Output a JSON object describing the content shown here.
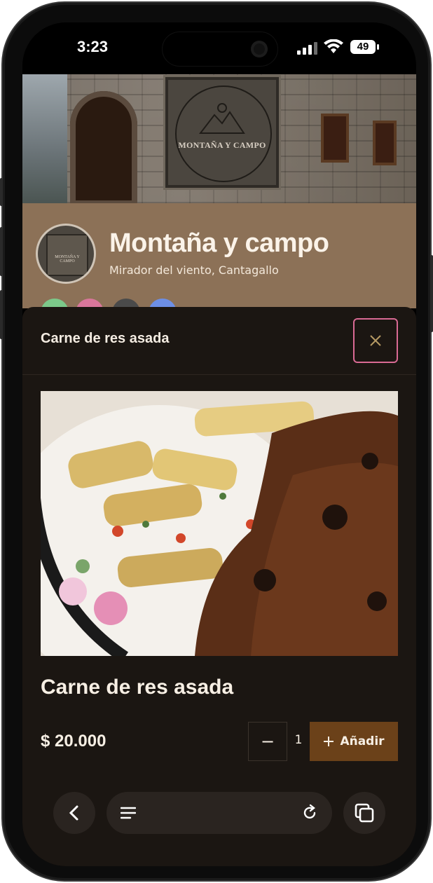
{
  "status_bar": {
    "time": "3:23",
    "battery_level": "49"
  },
  "restaurant": {
    "sign_text": "MONTAÑA Y CAMPO",
    "logo_text": "MONTAÑA Y CAMPO",
    "name": "Montaña y campo",
    "location": "Mirador del viento, Cantagallo",
    "social_dots": [
      {
        "color": "#7cc98a"
      },
      {
        "color": "#d9769b"
      },
      {
        "color": "#4a4a4a"
      },
      {
        "color": "#6d8fe6"
      }
    ]
  },
  "modal": {
    "header_title": "Carne de res asada",
    "close_icon": "close-icon",
    "product_name": "Carne de res asada",
    "price": "$ 20.000",
    "quantity": "1",
    "decrement_label": "−",
    "add_label": "Añadir"
  },
  "browser_bar": {
    "back_icon": "chevron-left-icon",
    "menu_icon": "menu-icon",
    "reload_icon": "reload-icon",
    "tabs_icon": "tabs-icon"
  },
  "colors": {
    "brand_bar": "#8c7157",
    "modal_bg": "#1b1612",
    "add_button": "#6b4119",
    "close_border": "#d96a94"
  }
}
